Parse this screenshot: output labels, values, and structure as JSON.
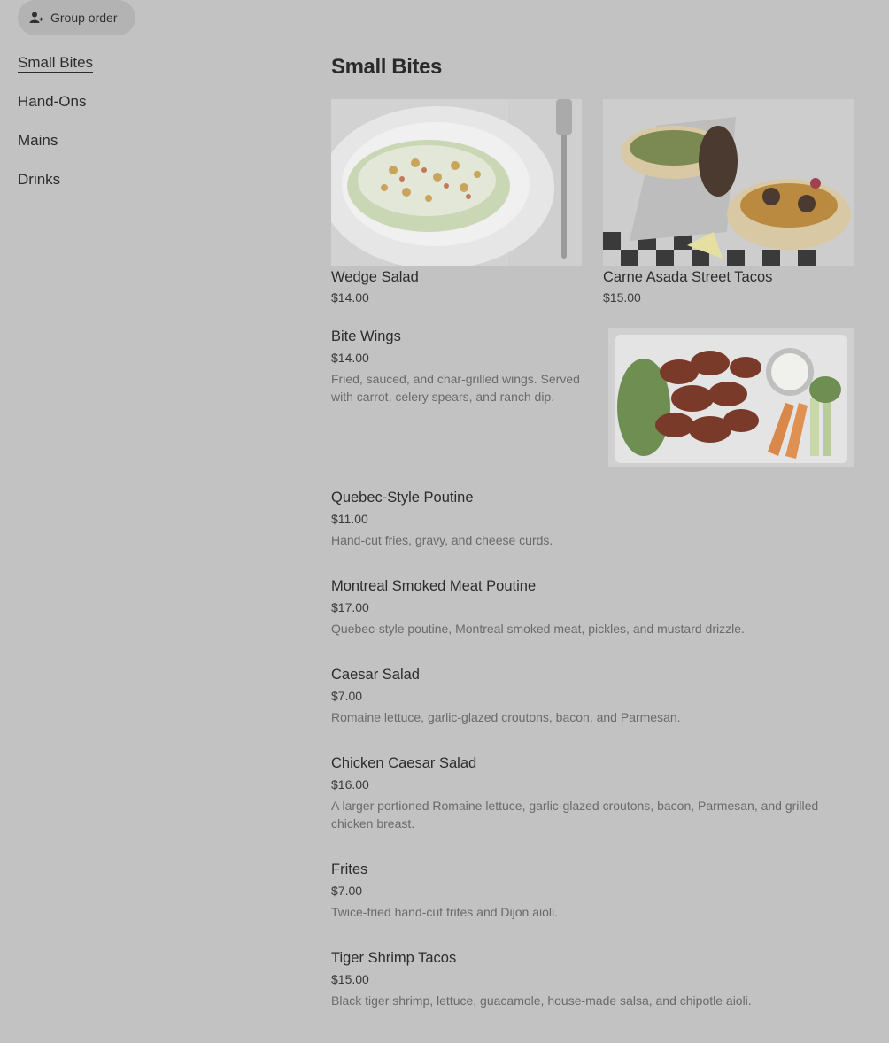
{
  "toolbar": {
    "group_order_label": "Group order",
    "group_order_icon": "person-plus-icon"
  },
  "nav": {
    "items": [
      {
        "label": "Small Bites",
        "active": true
      },
      {
        "label": "Hand-Ons"
      },
      {
        "label": "Mains"
      },
      {
        "label": "Drinks"
      }
    ]
  },
  "section": {
    "title": "Small Bites"
  },
  "featured": [
    {
      "name": "Wedge Salad",
      "price": "$14.00"
    },
    {
      "name": "Carne Asada Street Tacos",
      "price": "$15.00"
    }
  ],
  "items": [
    {
      "name": "Bite Wings",
      "price": "$14.00",
      "desc": "Fried, sauced, and char-grilled wings. Served with carrot, celery spears, and ranch dip."
    },
    {
      "name": "Quebec-Style Poutine",
      "price": "$11.00",
      "desc": "Hand-cut fries, gravy, and cheese curds."
    },
    {
      "name": "Montreal Smoked Meat Poutine",
      "price": "$17.00",
      "desc": "Quebec-style poutine, Montreal smoked meat, pickles, and mustard drizzle."
    },
    {
      "name": "Caesar Salad",
      "price": "$7.00",
      "desc": "Romaine lettuce, garlic-glazed croutons, bacon, and Parmesan."
    },
    {
      "name": "Chicken Caesar Salad",
      "price": "$16.00",
      "desc": "A larger portioned Romaine lettuce, garlic-glazed croutons, bacon, Parmesan, and grilled chicken breast."
    },
    {
      "name": "Frites",
      "price": "$7.00",
      "desc": "Twice-fried hand-cut frites and Dijon aioli."
    },
    {
      "name": "Tiger Shrimp Tacos",
      "price": "$15.00",
      "desc": "Black tiger shrimp, lettuce, guacamole, house-made salsa, and chipotle aioli."
    }
  ]
}
